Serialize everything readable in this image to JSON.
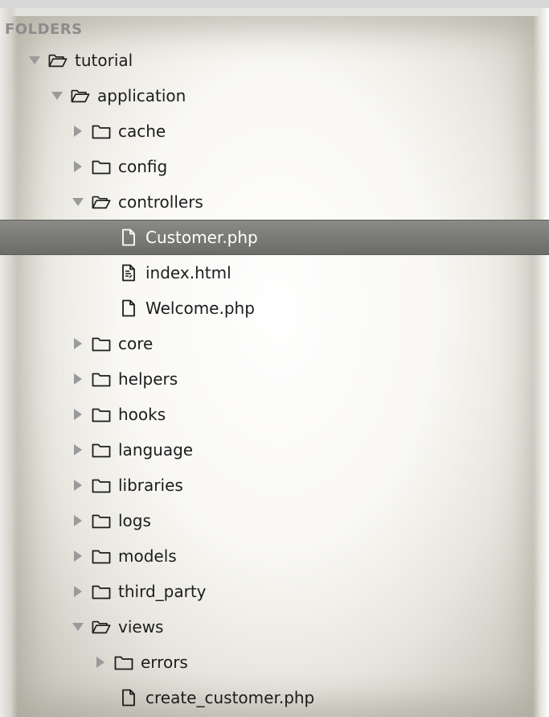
{
  "sidebar": {
    "header": "FOLDERS",
    "rows": [
      {
        "label": "tutorial",
        "type": "folder",
        "depth": 0,
        "expanded": true,
        "selected": false
      },
      {
        "label": "application",
        "type": "folder",
        "depth": 1,
        "expanded": true,
        "selected": false
      },
      {
        "label": "cache",
        "type": "folder",
        "depth": 2,
        "expanded": false,
        "selected": false
      },
      {
        "label": "config",
        "type": "folder",
        "depth": 2,
        "expanded": false,
        "selected": false
      },
      {
        "label": "controllers",
        "type": "folder",
        "depth": 2,
        "expanded": true,
        "selected": false
      },
      {
        "label": "Customer.php",
        "type": "file",
        "depth": 3,
        "selected": true
      },
      {
        "label": "index.html",
        "type": "file-html",
        "depth": 3,
        "selected": false
      },
      {
        "label": "Welcome.php",
        "type": "file",
        "depth": 3,
        "selected": false
      },
      {
        "label": "core",
        "type": "folder",
        "depth": 2,
        "expanded": false,
        "selected": false
      },
      {
        "label": "helpers",
        "type": "folder",
        "depth": 2,
        "expanded": false,
        "selected": false
      },
      {
        "label": "hooks",
        "type": "folder",
        "depth": 2,
        "expanded": false,
        "selected": false
      },
      {
        "label": "language",
        "type": "folder",
        "depth": 2,
        "expanded": false,
        "selected": false
      },
      {
        "label": "libraries",
        "type": "folder",
        "depth": 2,
        "expanded": false,
        "selected": false
      },
      {
        "label": "logs",
        "type": "folder",
        "depth": 2,
        "expanded": false,
        "selected": false
      },
      {
        "label": "models",
        "type": "folder",
        "depth": 2,
        "expanded": false,
        "selected": false
      },
      {
        "label": "third_party",
        "type": "folder",
        "depth": 2,
        "expanded": false,
        "selected": false
      },
      {
        "label": "views",
        "type": "folder",
        "depth": 2,
        "expanded": true,
        "selected": false
      },
      {
        "label": "errors",
        "type": "folder",
        "depth": 3,
        "expanded": false,
        "selected": false
      },
      {
        "label": "create_customer.php",
        "type": "file",
        "depth": 3,
        "selected": false
      }
    ]
  },
  "icons": {
    "folder_closed": "folder-icon",
    "folder_open": "folder-open-icon",
    "file": "file-icon",
    "file_html": "file-html-icon",
    "arrow_expanded": "triangle-down-icon",
    "arrow_collapsed": "triangle-right-icon"
  },
  "colors": {
    "header_text": "#8c8c8c",
    "row_text": "#1c1c1c",
    "selected_bg": "#7a7a77",
    "selected_text": "#ffffff",
    "arrow": "#9a9a9a"
  }
}
